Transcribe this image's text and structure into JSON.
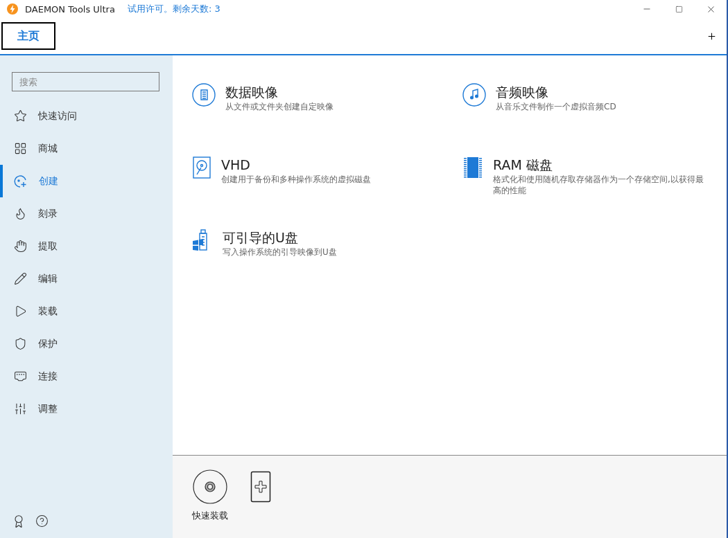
{
  "window": {
    "title": "DAEMON Tools Ultra",
    "license": "试用许可。剩余天数: 3"
  },
  "tabs": [
    {
      "label": "主页",
      "selected": true
    }
  ],
  "sidebar": {
    "search": {
      "placeholder": "搜索"
    },
    "items": [
      {
        "label": "快速访问",
        "selected": false
      },
      {
        "label": "商城",
        "selected": false
      },
      {
        "label": "创建",
        "selected": true
      },
      {
        "label": "刻录",
        "selected": false
      },
      {
        "label": "提取",
        "selected": false
      },
      {
        "label": "编辑",
        "selected": false
      },
      {
        "label": "装载",
        "selected": false
      },
      {
        "label": "保护",
        "selected": false
      },
      {
        "label": "连接",
        "selected": false
      },
      {
        "label": "调整",
        "selected": false
      }
    ]
  },
  "actions": [
    {
      "title": "数据映像",
      "description": "从文件或文件夹创建自定映像"
    },
    {
      "title": "音频映像",
      "description": "从音乐文件制作一个虚拟音频CD"
    },
    {
      "title": "VHD",
      "description": "创建用于备份和多种操作系统的虚拟磁盘"
    },
    {
      "title": "RAM 磁盘",
      "description": "格式化和使用随机存取存储器作为一个存储空间,以获得最高的性能"
    },
    {
      "title": "可引导的U盘",
      "description": "写入操作系统的引导映像到U盘"
    }
  ],
  "quick_bar": {
    "items": [
      {
        "label": "快速装载"
      }
    ]
  }
}
